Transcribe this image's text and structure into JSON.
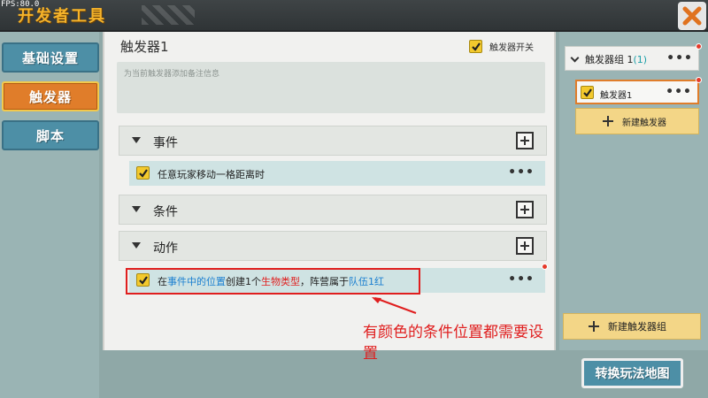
{
  "window": {
    "title": "开发者工具",
    "fps": "FPS:80.0"
  },
  "sidebar": {
    "items": [
      {
        "label": "基础设置",
        "active": false
      },
      {
        "label": "触发器",
        "active": true
      },
      {
        "label": "脚本",
        "active": false
      }
    ]
  },
  "trigger": {
    "name": "触发器1",
    "switch_label": "触发器开关",
    "switch_checked": true,
    "note_placeholder": "为当前触发器添加备注信息"
  },
  "sections": {
    "event": {
      "label": "事件",
      "rows": [
        {
          "text": "任意玩家移动一格距离时",
          "checked": true
        }
      ]
    },
    "condition": {
      "label": "条件",
      "rows": []
    },
    "action": {
      "label": "动作",
      "rows": [
        {
          "checked": true,
          "segments": [
            {
              "text": "在",
              "color": "normal"
            },
            {
              "text": "事件中的位置",
              "color": "blue"
            },
            {
              "text": "创建1个",
              "color": "normal"
            },
            {
              "text": "生物类型",
              "color": "red"
            },
            {
              "text": "，阵营属于",
              "color": "normal"
            },
            {
              "text": "队伍1红",
              "color": "blue"
            }
          ]
        }
      ]
    }
  },
  "more_label": "•••",
  "annotation": {
    "text": "有颜色的条件位置都需要设置"
  },
  "right_panel": {
    "group_label": "触发器组 1",
    "group_count": "(1)",
    "trigger_item": "触发器1",
    "new_trigger_label": "新建触发器",
    "new_group_label": "新建触发器组"
  },
  "switch_map_label": "转换玩法地图",
  "colors": {
    "accent_orange": "#e07d2a",
    "highlight_blue": "#1b7fd0",
    "highlight_red": "#e01e1e",
    "checkbox_yellow": "#f3c92d",
    "title_gold": "#f5b32a"
  }
}
